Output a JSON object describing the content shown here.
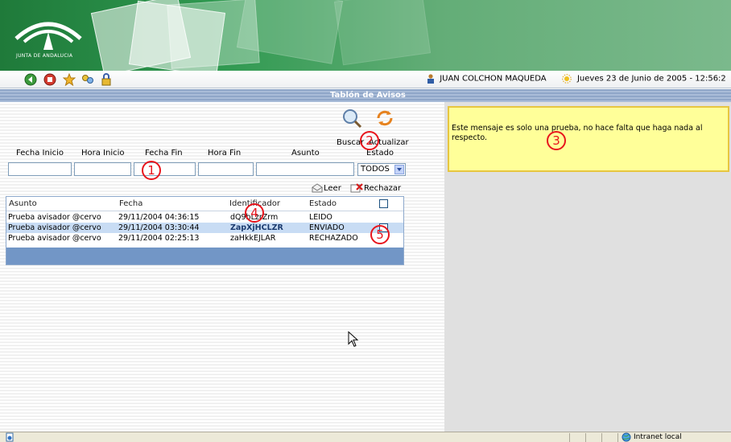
{
  "banner": {
    "org_name": "JUNTA DE ANDALUCIA"
  },
  "toolbar": {
    "icons": [
      "back-icon",
      "stop-icon",
      "star-icon",
      "keys-icon",
      "lock-icon"
    ],
    "user_name": "JUAN COLCHON MAQUEDA",
    "datetime": "Jueves 23 de Junio de 2005 - 12:56:2"
  },
  "title": "Tablón de Avisos",
  "actions": {
    "buscar": "Buscar",
    "actualizar": "Actualizar",
    "leer": "Leer",
    "rechazar": "Rechazar"
  },
  "filters": {
    "labels": {
      "fecha_inicio": "Fecha Inicio",
      "hora_inicio": "Hora Inicio",
      "fecha_fin": "Fecha Fin",
      "hora_fin": "Hora Fin",
      "asunto": "Asunto",
      "estado": "Estado"
    },
    "estado_value": "TODOS"
  },
  "table": {
    "headers": [
      "Asunto",
      "Fecha",
      "Identificador",
      "Estado"
    ],
    "rows": [
      {
        "asunto": "Prueba avisador @cervo",
        "fecha": "29/11/2004 04:36:15",
        "id": "dQ9bLzrZrm",
        "estado": "LEIDO"
      },
      {
        "asunto": "Prueba avisador @cervo",
        "fecha": "29/11/2004 03:30:44",
        "id": "ZapXjHCLZR",
        "estado": "ENVIADO"
      },
      {
        "asunto": "Prueba avisador @cervo",
        "fecha": "29/11/2004 02:25:13",
        "id": "zaHkkEJLAR",
        "estado": "RECHAZADO"
      }
    ]
  },
  "note": {
    "text": "Este mensaje es solo una prueba, no hace falta que haga nada al respecto."
  },
  "status": {
    "zone": "Intranet local"
  },
  "annotations": [
    "1",
    "2",
    "3",
    "4",
    "5"
  ],
  "colors": {
    "header_bar": "#8fa6c8",
    "table_footer": "#7296c6",
    "note_bg": "#ffff99",
    "annotation": "#e8141c"
  }
}
